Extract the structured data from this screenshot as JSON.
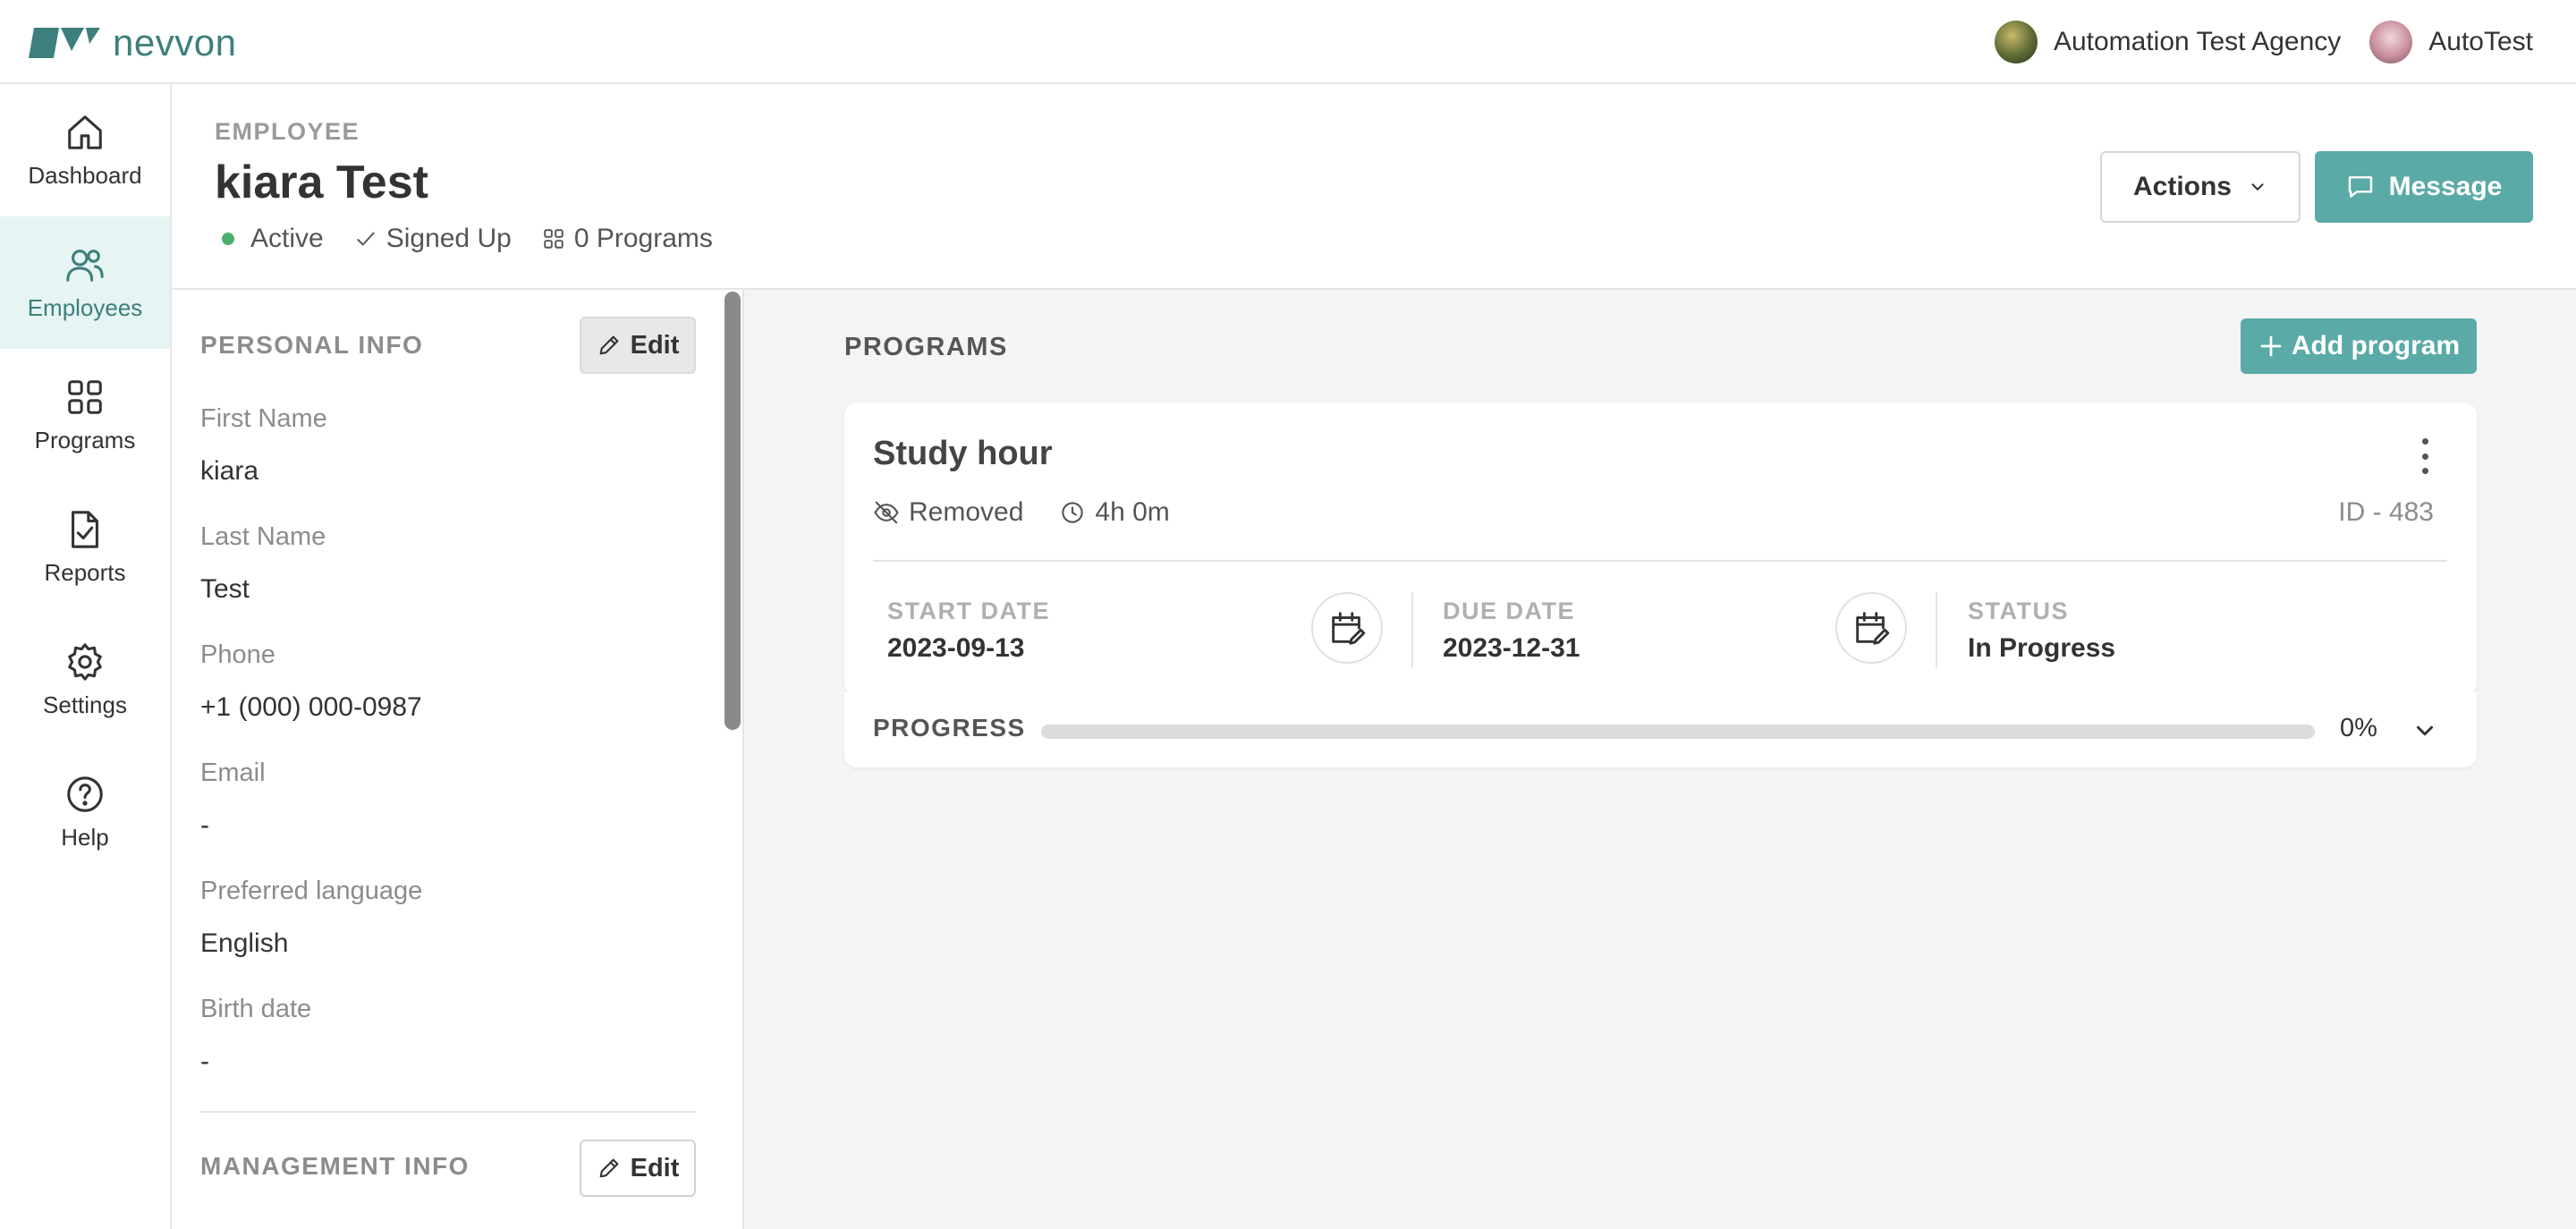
{
  "brand": {
    "name": "nevvon",
    "color": "#3d7f7c"
  },
  "topbar": {
    "agency": "Automation Test Agency",
    "user": "AutoTest"
  },
  "nav": [
    {
      "label": "Dashboard",
      "icon": "home-icon",
      "active": false
    },
    {
      "label": "Employees",
      "icon": "users-icon",
      "active": true
    },
    {
      "label": "Programs",
      "icon": "grid-icon",
      "active": false
    },
    {
      "label": "Reports",
      "icon": "report-icon",
      "active": false
    },
    {
      "label": "Settings",
      "icon": "gear-icon",
      "active": false
    },
    {
      "label": "Help",
      "icon": "help-icon",
      "active": false
    }
  ],
  "header": {
    "eyebrow": "EMPLOYEE",
    "name": "kiara Test",
    "status": "Active",
    "signup": "Signed Up",
    "programs_count": "0 Programs",
    "actions_label": "Actions",
    "message_label": "Message"
  },
  "personal": {
    "title": "PERSONAL INFO",
    "edit_label": "Edit",
    "fields": [
      {
        "label": "First Name",
        "value": "kiara"
      },
      {
        "label": "Last Name",
        "value": "Test"
      },
      {
        "label": "Phone",
        "value": "+1 (000) 000-0987"
      },
      {
        "label": "Email",
        "value": "-"
      },
      {
        "label": "Preferred language",
        "value": "English"
      },
      {
        "label": "Birth date",
        "value": "-"
      }
    ]
  },
  "management": {
    "title": "MANAGEMENT INFO",
    "edit_label": "Edit"
  },
  "programs": {
    "title": "PROGRAMS",
    "add_label": "Add program",
    "card": {
      "title": "Study hour",
      "visibility": "Removed",
      "duration": "4h 0m",
      "id": "ID - 483",
      "start_label": "START DATE",
      "start_value": "2023-09-13",
      "due_label": "DUE DATE",
      "due_value": "2023-12-31",
      "status_label": "STATUS",
      "status_value": "In Progress",
      "progress_label": "PROGRESS",
      "progress_value": 0,
      "progress_text": "0%"
    }
  },
  "colors": {
    "accent": "#5aaaa7",
    "active_dot": "#4caf6e",
    "nav_active_bg": "#e6f4f3"
  }
}
